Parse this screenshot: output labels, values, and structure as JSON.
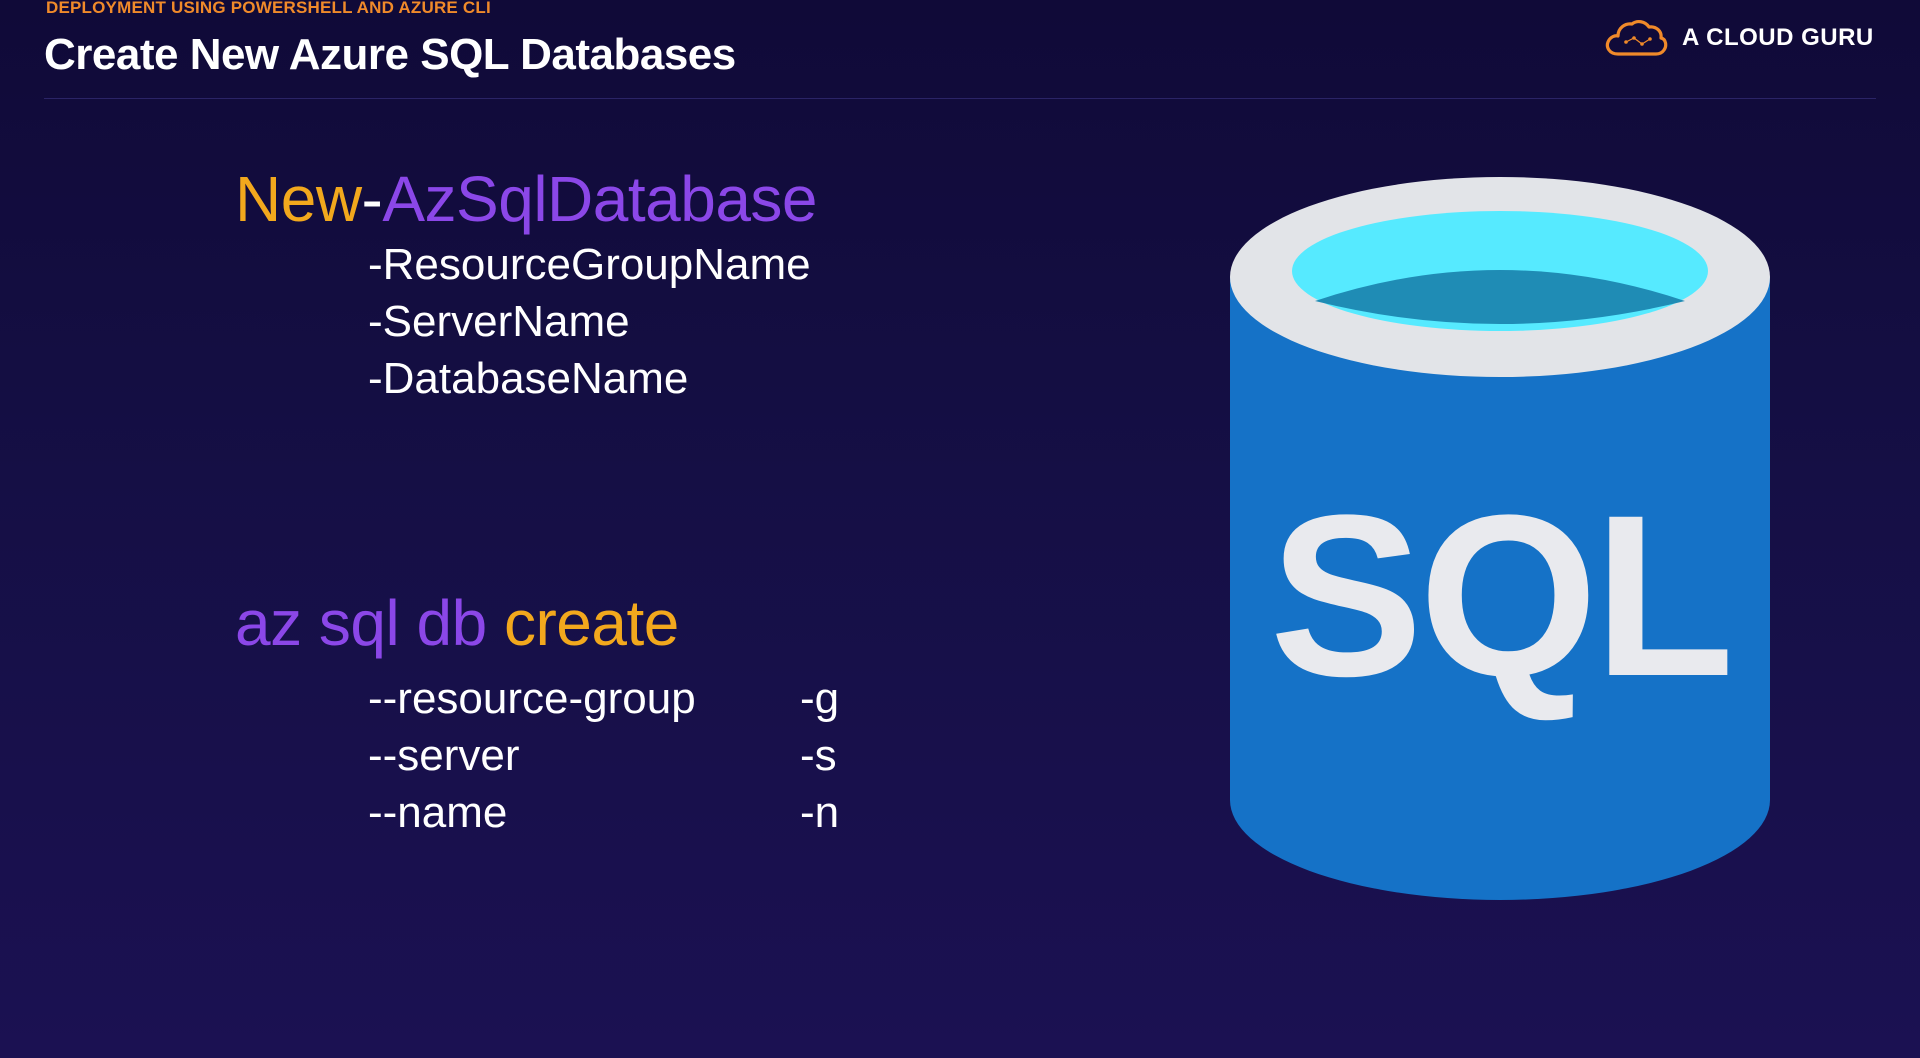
{
  "slide": {
    "eyebrow": "DEPLOYMENT USING POWERSHELL AND AZURE CLI",
    "title": "Create New Azure SQL Databases"
  },
  "logo": {
    "icon": "cloud-icon",
    "text": "A CLOUD GURU",
    "color": "#f08a2a"
  },
  "powershell": {
    "verb": "New",
    "dash": "-",
    "noun": "AzSqlDatabase",
    "params": [
      "-ResourceGroupName",
      "-ServerName",
      "-DatabaseName"
    ]
  },
  "cli": {
    "prefix": "az sql db",
    "space": " ",
    "action": "create",
    "params": [
      {
        "long": "--resource-group",
        "short": "-g"
      },
      {
        "long": "--server",
        "short": "-s"
      },
      {
        "long": "--name",
        "short": "-n"
      }
    ]
  },
  "sql_icon": {
    "icon": "sql-database-icon",
    "label": "SQL",
    "colors": {
      "body": "#1572c7",
      "rim": "#e2e4e8",
      "top": "#56eaff",
      "inner": "#1f8cb5",
      "text": "#e9eaee"
    }
  },
  "colors": {
    "accent_orange": "#f2a81d",
    "accent_purple": "#8b47e8",
    "eyebrow_orange": "#f08a2a",
    "background": "#150f45"
  }
}
